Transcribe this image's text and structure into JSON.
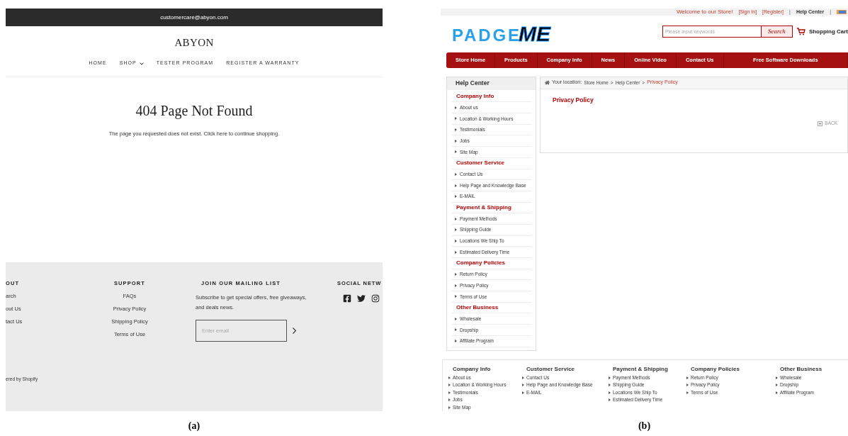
{
  "screenshot_a": {
    "top_bar": "customercare@abyon.com",
    "logo": "ABYON",
    "nav": [
      {
        "label": "HOME",
        "dropdown": false
      },
      {
        "label": "SHOP",
        "dropdown": true
      },
      {
        "label": "TESTER PROGRAM",
        "dropdown": false
      },
      {
        "label": "REGISTER A WARRANTY",
        "dropdown": false
      }
    ],
    "heading": "404 Page Not Found",
    "message": "The page you requested does not exist. Click here to continue shopping.",
    "footer": {
      "about": {
        "title": "OUT",
        "links": [
          "arch",
          "out Us",
          "tact Us"
        ]
      },
      "support": {
        "title": "SUPPORT",
        "links": [
          "FAQs",
          "Privacy Policy",
          "Shipping Policy",
          "Terms of Use"
        ]
      },
      "mailing": {
        "title": "JOIN OUR MAILING LIST",
        "text": "Subscribe to get special offers, free giveaways, and deals news.",
        "placeholder": "Enter email"
      },
      "social": {
        "title": "SOCIAL NETW"
      },
      "powered": "ered by Shopify"
    }
  },
  "screenshot_b": {
    "top_bar": {
      "welcome": "Welcome to our Store!",
      "links": [
        "[Sign In]",
        "[Register]"
      ],
      "separator": "|",
      "help": "Help Center"
    },
    "logo": {
      "part_1": "PADGE",
      "part_2": "ME"
    },
    "search": {
      "placeholder": "Please input keywords",
      "button": "Search"
    },
    "cart": "Shopping Cart",
    "nav": [
      "Store Home",
      "Products",
      "Company Info",
      "News",
      "Online Video",
      "Contact Us",
      "Free Software Downloads"
    ],
    "sidebar": {
      "title": "Help Center",
      "groups": [
        {
          "title": "Company Info",
          "items": [
            "About us",
            "Location & Working Hours",
            "Testimonials",
            "Jobs",
            "Site Map"
          ]
        },
        {
          "title": "Customer Service",
          "items": [
            "Contact Us",
            "Help Page and Knowledge Base",
            "E-MAIL"
          ]
        },
        {
          "title": "Payment & Shipping",
          "items": [
            "Payment Methods",
            "Shipping Guide",
            "Locations We Ship To",
            "Estimated Delivery Time"
          ]
        },
        {
          "title": "Company Policies",
          "items": [
            "Return Policy",
            "Privacy Policy",
            "Terms of Use"
          ]
        },
        {
          "title": "Other Business",
          "items": [
            "Wholesale",
            "Dropship",
            "Affiliate Program"
          ]
        }
      ]
    },
    "breadcrumb": {
      "label": "Your location:",
      "trail": [
        "Store Home",
        ">",
        "Help Center",
        ">"
      ],
      "current": "Privacy Policy"
    },
    "content_title": "Privacy Policy",
    "back": "BACK",
    "footer": [
      {
        "title": "Company Info",
        "items": [
          "About us",
          "Location & Working Hours",
          "Testimonials",
          "Jobs",
          "Site Map"
        ]
      },
      {
        "title": "Customer Service",
        "items": [
          "Contact Us",
          "Help Page and Knowledge Base",
          "E-MAIL"
        ]
      },
      {
        "title": "Payment & Shipping",
        "items": [
          "Payment Methods",
          "Shipping Guide",
          "Locations We Ship To",
          "Estimated Delivery Time"
        ]
      },
      {
        "title": "Company Policies",
        "items": [
          "Return Policy",
          "Privacy Policy",
          "Terms of Use"
        ]
      },
      {
        "title": "Other Business",
        "items": [
          "Wholesale",
          "Dropship",
          "Affiliate Program"
        ]
      }
    ]
  },
  "captions": [
    "(a)",
    "(b)"
  ]
}
